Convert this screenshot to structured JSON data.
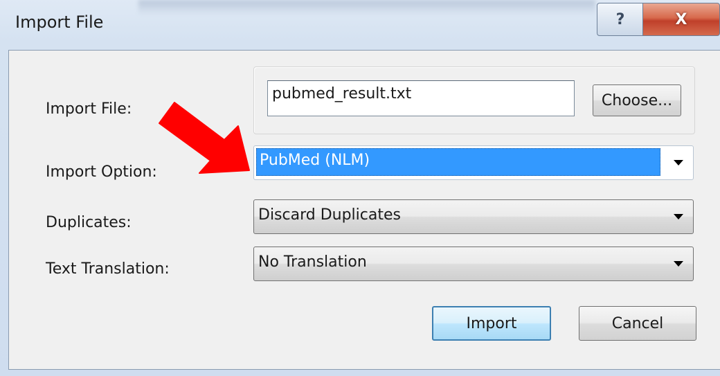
{
  "window": {
    "title": "Import File",
    "help_glyph": "?",
    "close_glyph": "X"
  },
  "form": {
    "import_file_label": "Import File:",
    "import_file_value": "pubmed_result.txt",
    "choose_button_label": "Choose...",
    "import_option_label": "Import Option:",
    "import_option_value": "PubMed (NLM)",
    "duplicates_label": "Duplicates:",
    "duplicates_value": "Discard Duplicates",
    "text_translation_label": "Text Translation:",
    "text_translation_value": "No Translation"
  },
  "actions": {
    "import_label": "Import",
    "cancel_label": "Cancel"
  },
  "colors": {
    "selection_highlight": "#3399ff",
    "annotation_arrow": "#ff0000",
    "close_button": "#c9452e",
    "default_button_border": "#3c7fb1"
  },
  "icons": {
    "help": "question-mark-icon",
    "close": "close-icon",
    "dropdown": "chevron-down-icon",
    "annotation": "red-arrow-icon"
  }
}
